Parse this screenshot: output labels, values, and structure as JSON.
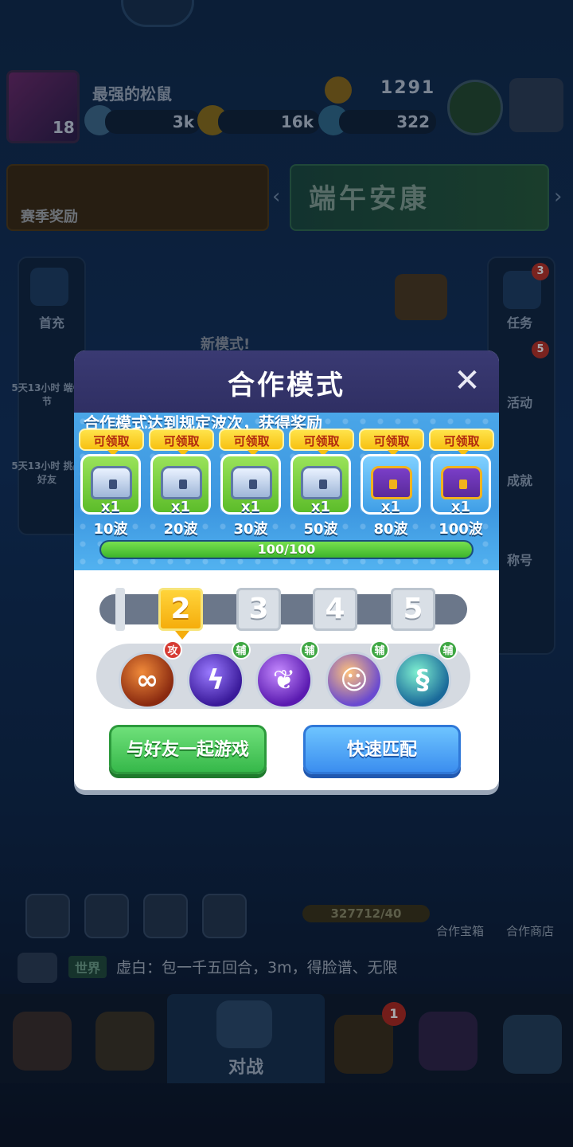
{
  "background": {
    "player": {
      "name": "最强的松鼠",
      "level": "18",
      "trophies": "1291"
    },
    "currencies": [
      "3k",
      "16k",
      "322"
    ],
    "season_label": "赛季奖励",
    "banner_title": "端午安康",
    "left_sidebar": [
      "首充",
      "5天13小时 端午节",
      "5天13小时 挑战好友"
    ],
    "right_sidebar": [
      {
        "label": "任务",
        "badge": "3"
      },
      {
        "label": "活动",
        "badge": "5"
      },
      {
        "label": "成就",
        "badge": ""
      },
      {
        "label": "称号",
        "badge": ""
      }
    ],
    "new_mode_tag": "新模式!",
    "coop_progress_text": "327712/40",
    "coop_links": [
      "合作宝箱",
      "合作商店"
    ],
    "chat": {
      "channel": "世界",
      "message": "虚白：包一千五回合，3m，得脸谱、无限"
    },
    "nav": {
      "active_label": "对战",
      "badge": "1"
    }
  },
  "modal": {
    "title": "合作模式",
    "close_icon": "close-icon",
    "reward_description": "合作模式达到规定波次，获得奖励",
    "rewards": [
      {
        "tag": "可领取",
        "qty": "x1",
        "wave": "10波",
        "chest": "silver",
        "frame": "green"
      },
      {
        "tag": "可领取",
        "qty": "x1",
        "wave": "20波",
        "chest": "silver",
        "frame": "green"
      },
      {
        "tag": "可领取",
        "qty": "x1",
        "wave": "30波",
        "chest": "silver",
        "frame": "green"
      },
      {
        "tag": "可领取",
        "qty": "x1",
        "wave": "50波",
        "chest": "silver",
        "frame": "green"
      },
      {
        "tag": "可领取",
        "qty": "x1",
        "wave": "80波",
        "chest": "gold",
        "frame": "blue"
      },
      {
        "tag": "可领取",
        "qty": "x1",
        "wave": "100波",
        "chest": "gold",
        "frame": "blue"
      }
    ],
    "progress": {
      "text": "100/100",
      "fraction": 1.0
    },
    "player_slots": [
      "2",
      "3",
      "4",
      "5"
    ],
    "selected_slot": "2",
    "skills": [
      {
        "icon": "infinity-orb-icon",
        "badge": "攻",
        "badge_color": "#d63b33"
      },
      {
        "icon": "lightning-orb-icon",
        "badge": "辅",
        "badge_color": "#3ea743"
      },
      {
        "icon": "leaf-orb-icon",
        "badge": "辅",
        "badge_color": "#3ea743"
      },
      {
        "icon": "figures-orb-icon",
        "badge": "辅",
        "badge_color": "#3ea743"
      },
      {
        "icon": "dragon-orb-icon",
        "badge": "辅",
        "badge_color": "#3ea743"
      }
    ],
    "buttons": {
      "play_with_friends": "与好友一起游戏",
      "quick_match": "快速匹配"
    }
  }
}
